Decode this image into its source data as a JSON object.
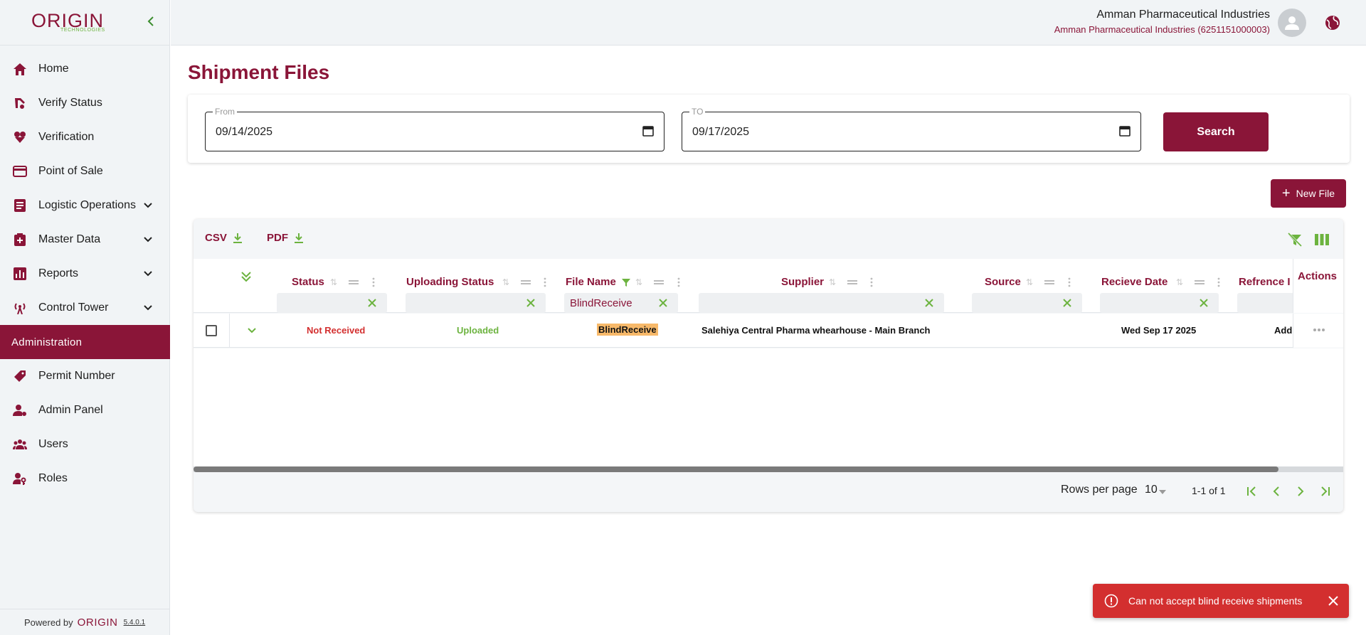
{
  "brand": {
    "name": "ORIGIN",
    "tagline": "TECHNOLOGIES",
    "color": "#8a1538",
    "accent": "#6cb33f"
  },
  "sidebar": {
    "items": [
      {
        "label": "Home",
        "icon": "home-icon"
      },
      {
        "label": "Verify Status",
        "icon": "verify-icon"
      },
      {
        "label": "Verification",
        "icon": "verification-icon"
      },
      {
        "label": "Point of Sale",
        "icon": "credit-card-icon"
      },
      {
        "label": "Logistic Operations",
        "icon": "list-icon",
        "expandable": true
      },
      {
        "label": "Master Data",
        "icon": "medical-box-icon",
        "expandable": true
      },
      {
        "label": "Reports",
        "icon": "bar-chart-icon",
        "expandable": true
      },
      {
        "label": "Control Tower",
        "icon": "tower-icon",
        "expandable": true
      }
    ],
    "section_label": "Administration",
    "admin_items": [
      {
        "label": "Permit Number",
        "icon": "tag-icon"
      },
      {
        "label": "Admin Panel",
        "icon": "user-settings-icon"
      },
      {
        "label": "Users",
        "icon": "users-icon"
      },
      {
        "label": "Roles",
        "icon": "user-key-icon"
      }
    ],
    "footer": {
      "powered_by": "Powered by",
      "logo": "ORIGIN",
      "version": "5.4.0.1"
    }
  },
  "header": {
    "company": "Amman Pharmaceutical Industries",
    "company_sub": "Amman Pharmaceutical Industries (6251151000003)"
  },
  "page": {
    "title": "Shipment Files"
  },
  "filters": {
    "from_label": "From",
    "from_value": "09/14/2025",
    "to_label": "TO",
    "to_value": "09/17/2025",
    "search_label": "Search"
  },
  "new_file_label": "New File",
  "table": {
    "export_csv": "CSV",
    "export_pdf": "PDF",
    "columns": [
      "Status",
      "Uploading Status",
      "File Name",
      "Supplier",
      "Source",
      "Recieve Date",
      "Refrence I",
      "Actions"
    ],
    "file_name_filter": "BlindReceive",
    "rows": [
      {
        "status": "Not Received",
        "uploading_status": "Uploaded",
        "file_name": "BlindReceive",
        "supplier": "Salehiya Central Pharma whearhouse - Main Branch",
        "source": "",
        "receive_date": "Wed Sep 17 2025",
        "reference": "Add"
      }
    ],
    "rows_per_page_label": "Rows per page",
    "rows_per_page_value": "10",
    "range_label": "1-1 of 1",
    "status_colors": {
      "not_received": "#d32f2f",
      "uploaded": "#6cb33f"
    }
  },
  "toast": {
    "message": "Can not accept blind receive shipments",
    "color": "#d32f2f"
  }
}
